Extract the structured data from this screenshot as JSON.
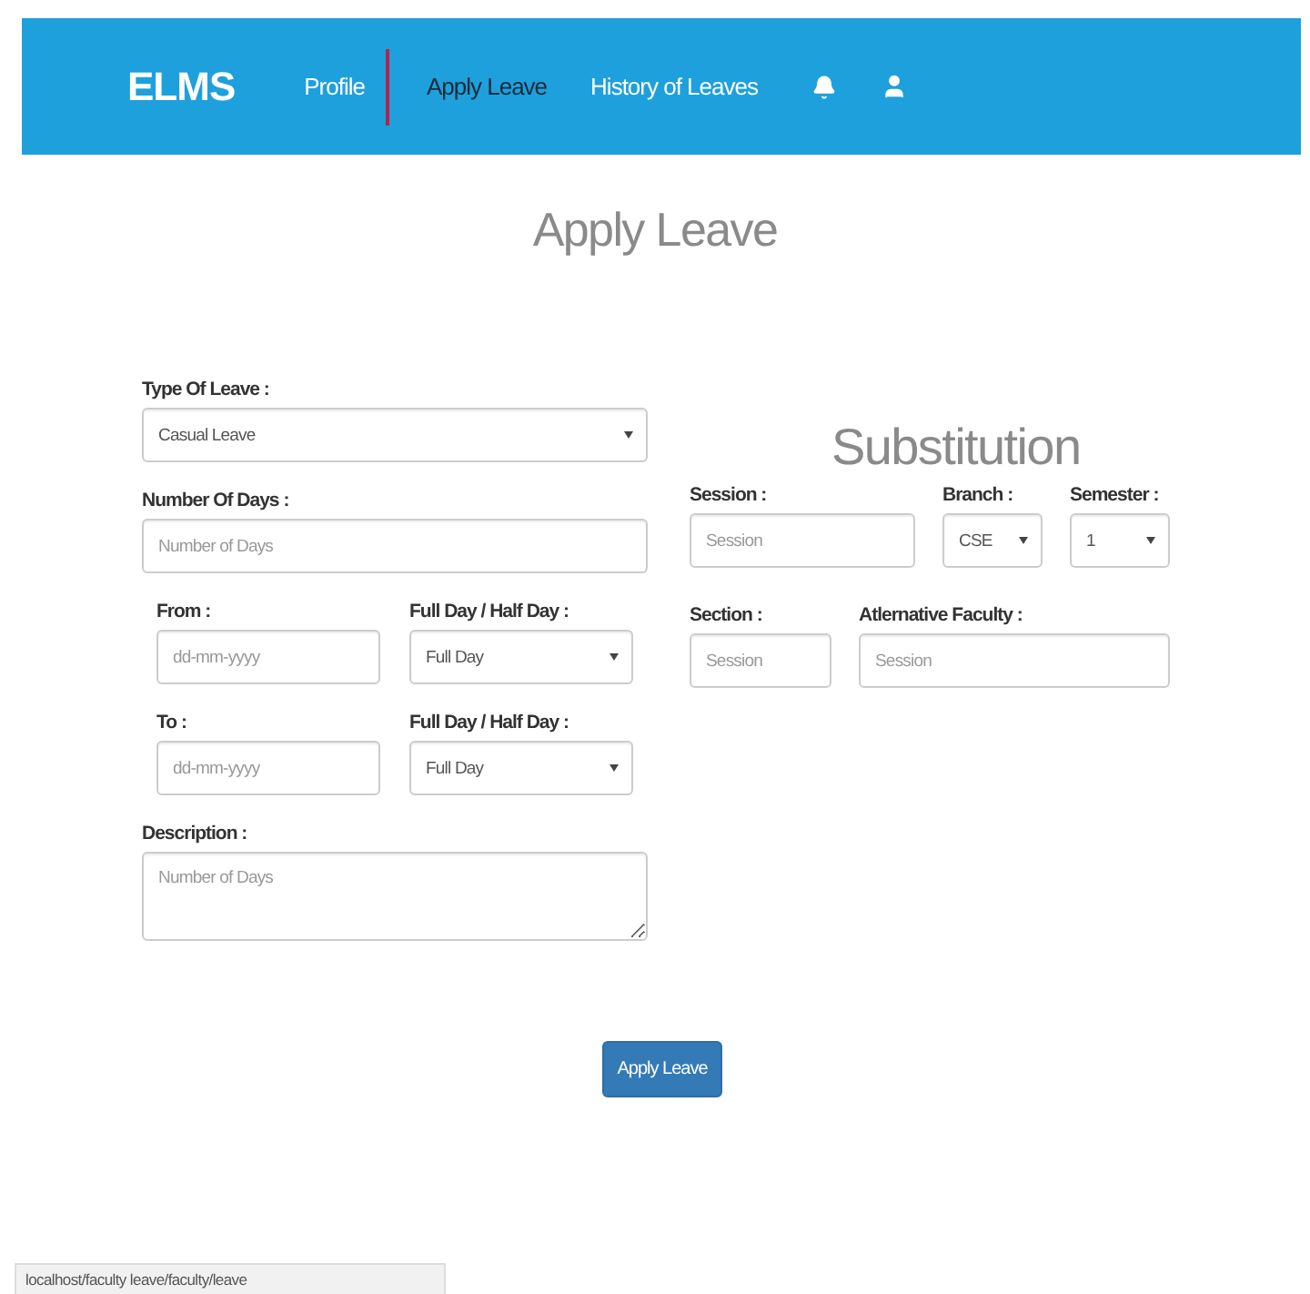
{
  "navbar": {
    "brand": "ELMS",
    "links": [
      {
        "label": "Profile",
        "selected": false
      },
      {
        "label": "Apply Leave",
        "selected": true
      },
      {
        "label": "History of Leaves",
        "selected": false
      }
    ]
  },
  "page_title": "Apply Leave",
  "leave_form": {
    "rows": [
      [
        {
          "kind": "select",
          "label": "Type Of Leave :",
          "value": "Casual Leave"
        }
      ],
      [
        {
          "kind": "input",
          "label": "Number Of Days :",
          "placeholder": "Number of Days"
        }
      ],
      [
        {
          "kind": "input",
          "label": "From :",
          "placeholder": "dd-mm-yyyy"
        },
        {
          "kind": "select",
          "label": "Full Day / Half Day :",
          "value": "Full Day"
        }
      ],
      [
        {
          "kind": "input",
          "label": "To :",
          "placeholder": "dd-mm-yyyy"
        },
        {
          "kind": "select",
          "label": "Full Day / Half Day :",
          "value": "Full Day"
        }
      ],
      [
        {
          "kind": "textarea",
          "label": "Description :",
          "placeholder": "Number of Days"
        }
      ]
    ]
  },
  "substitution": {
    "title": "Substitution",
    "rows": [
      [
        {
          "kind": "input",
          "label": "Session :",
          "placeholder": "Session"
        },
        {
          "kind": "select",
          "label": "Branch :",
          "value": "CSE"
        },
        {
          "kind": "select",
          "label": "Semester :",
          "value": "1"
        }
      ],
      [
        {
          "kind": "input",
          "label": "Section :",
          "placeholder": "Session"
        },
        {
          "kind": "input",
          "label": "Atlernative Faculty :",
          "placeholder": "Session"
        }
      ]
    ]
  },
  "submit_button": "Apply Leave",
  "status_bar": "localhost/faculty leave/faculty/leave"
}
